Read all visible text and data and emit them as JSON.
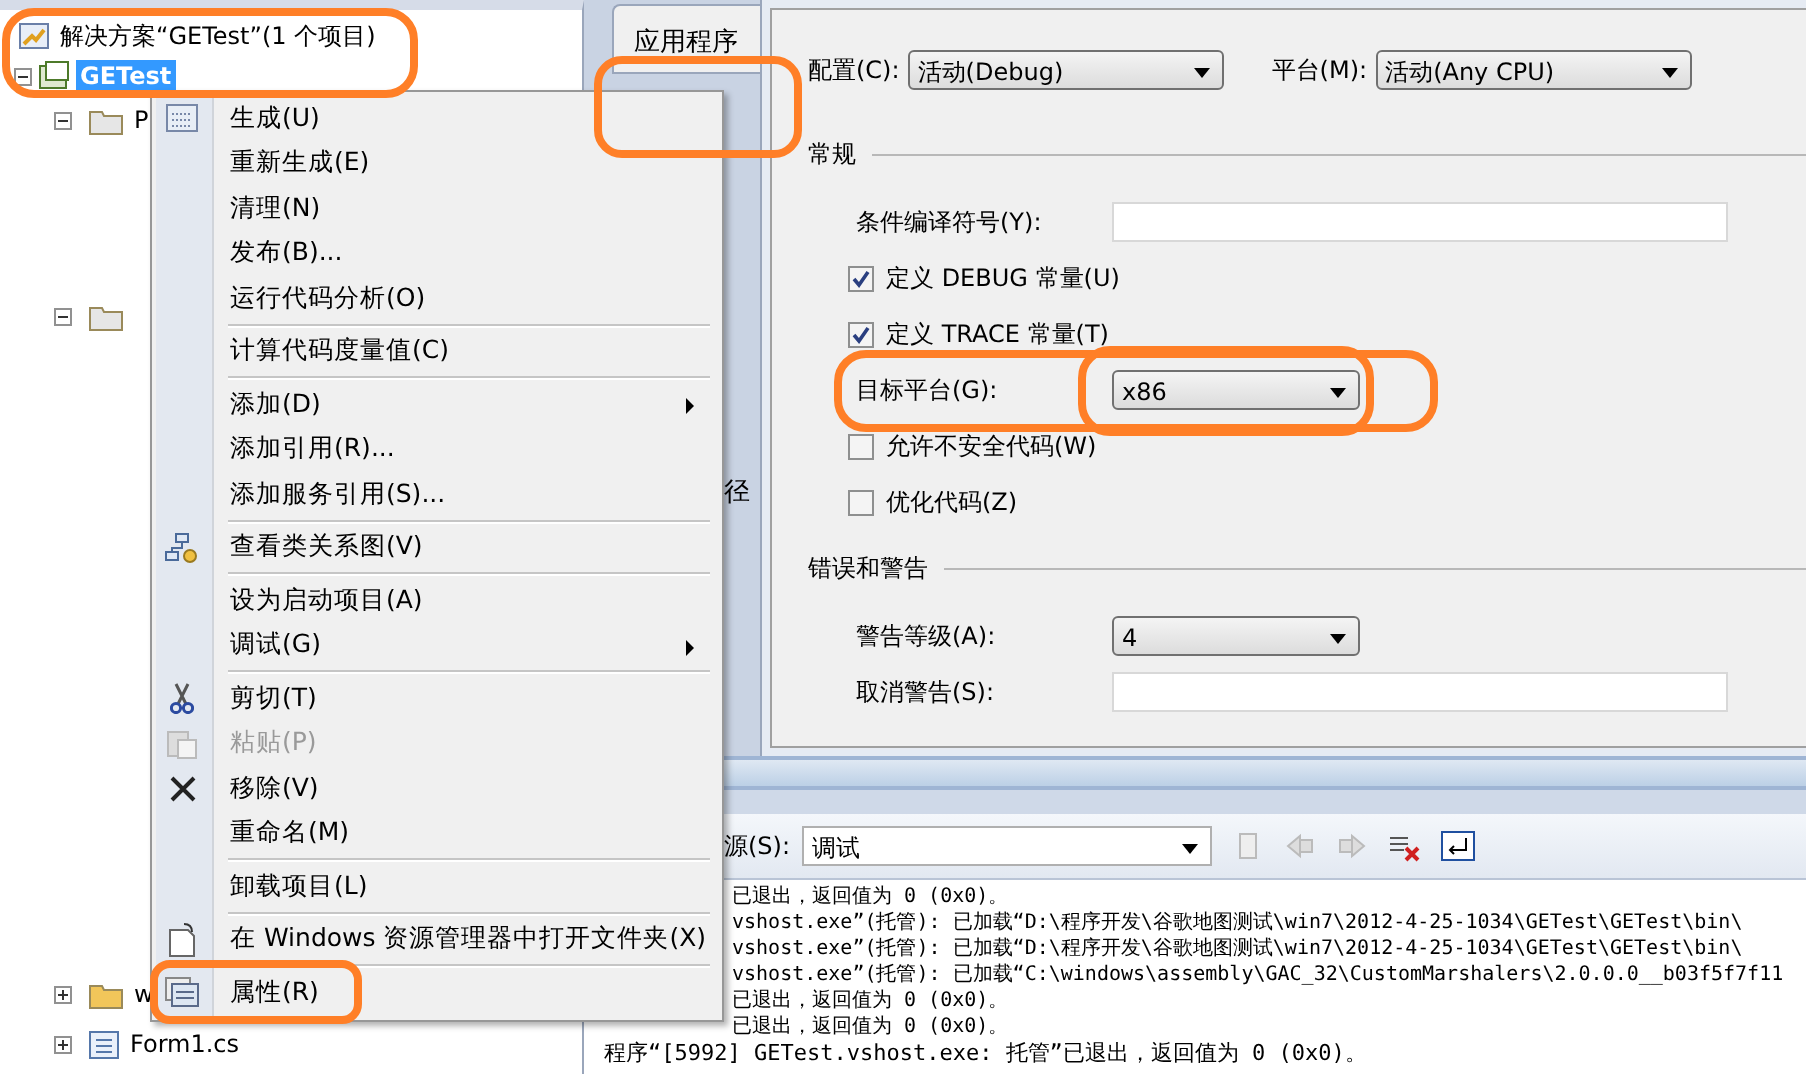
{
  "solution_explorer": {
    "solution": "解决方案“GETest”(1 个项目)",
    "project": {
      "label": "GETest",
      "selected": true,
      "expanded": true
    },
    "items": [
      {
        "label": "P",
        "kind": "folder",
        "expanded": true
      },
      {
        "kind": "folder",
        "expanded": true
      },
      {
        "label": "w",
        "kind": "folder",
        "expanded": false
      },
      {
        "label": "Form1.cs",
        "kind": "form",
        "expanded": false
      }
    ]
  },
  "property_pages": {
    "tabs": [
      {
        "label": "应用程序",
        "selected": true
      },
      {
        "label": "径",
        "selected": false
      }
    ],
    "config": {
      "label": "配置(C):",
      "value": "活动(Debug)"
    },
    "platform": {
      "label": "平台(M):",
      "value": "活动(Any CPU)"
    },
    "sections": [
      {
        "title": "常规",
        "rows": [
          {
            "kind": "text",
            "label": "条件编译符号(Y):"
          },
          {
            "kind": "check",
            "label": "定义 DEBUG 常量(U)",
            "checked": true
          },
          {
            "kind": "check",
            "label": "定义 TRACE 常量(T)",
            "checked": true
          },
          {
            "kind": "select",
            "label": "目标平台(G):",
            "value": "x86"
          },
          {
            "kind": "check",
            "label": "允许不安全代码(W)",
            "checked": false
          },
          {
            "kind": "check",
            "label": "优化代码(Z)",
            "checked": false
          }
        ]
      },
      {
        "title": "错误和警告",
        "rows": [
          {
            "kind": "select",
            "label": "警告等级(A):",
            "value": "4"
          },
          {
            "kind": "text",
            "label": "取消警告(S):"
          }
        ]
      }
    ]
  },
  "output": {
    "source_label": "源(S):",
    "source": "调试",
    "lines": [
      {
        "kind": "partial",
        "text": "已退出，返回值为 0 (0x0)。"
      },
      {
        "kind": "partial",
        "text": "vshost.exe”(托管): 已加载“D:\\程序开发\\谷歌地图测试\\win7\\2012-4-25-1034\\GETest\\GETest\\bin\\"
      },
      {
        "kind": "partial",
        "text": "vshost.exe”(托管): 已加载“D:\\程序开发\\谷歌地图测试\\win7\\2012-4-25-1034\\GETest\\GETest\\bin\\"
      },
      {
        "kind": "partial",
        "text": "vshost.exe”(托管): 已加载“C:\\windows\\assembly\\GAC_32\\CustomMarshalers\\2.0.0.0__b03f5f7f11"
      },
      {
        "kind": "partial",
        "text": "已退出，返回值为 0 (0x0)。"
      },
      {
        "kind": "partial",
        "text": "已退出，返回值为 0 (0x0)。"
      },
      {
        "kind": "full",
        "text": "程序“[5992] GETest.vshost.exe: 托管”已退出，返回值为 0 (0x0)。"
      }
    ]
  },
  "context_menu": {
    "items": [
      {
        "kind": "item",
        "label": "生成(U)",
        "submenu": false,
        "disabled": false
      },
      {
        "kind": "item",
        "label": "重新生成(E)",
        "submenu": false,
        "disabled": false
      },
      {
        "kind": "item",
        "label": "清理(N)",
        "submenu": false,
        "disabled": false
      },
      {
        "kind": "item",
        "label": "发布(B)...",
        "submenu": false,
        "disabled": false
      },
      {
        "kind": "item",
        "label": "运行代码分析(O)",
        "submenu": false,
        "disabled": false
      },
      {
        "kind": "separator"
      },
      {
        "kind": "item",
        "label": "计算代码度量值(C)",
        "submenu": false,
        "disabled": false
      },
      {
        "kind": "separator"
      },
      {
        "kind": "item",
        "label": "添加(D)",
        "submenu": true,
        "disabled": false
      },
      {
        "kind": "item",
        "label": "添加引用(R)...",
        "submenu": false,
        "disabled": false
      },
      {
        "kind": "item",
        "label": "添加服务引用(S)...",
        "submenu": false,
        "disabled": false
      },
      {
        "kind": "separator"
      },
      {
        "kind": "item",
        "label": "查看类关系图(V)",
        "submenu": false,
        "disabled": false
      },
      {
        "kind": "separator"
      },
      {
        "kind": "item",
        "label": "设为启动项目(A)",
        "submenu": false,
        "disabled": false
      },
      {
        "kind": "item",
        "label": "调试(G)",
        "submenu": true,
        "disabled": false
      },
      {
        "kind": "separator"
      },
      {
        "kind": "item",
        "label": "剪切(T)",
        "submenu": false,
        "disabled": false
      },
      {
        "kind": "item",
        "label": "粘贴(P)",
        "submenu": false,
        "disabled": true
      },
      {
        "kind": "item",
        "label": "移除(V)",
        "submenu": false,
        "disabled": false
      },
      {
        "kind": "item",
        "label": "重命名(M)",
        "submenu": false,
        "disabled": false
      },
      {
        "kind": "separator"
      },
      {
        "kind": "item",
        "label": "卸载项目(L)",
        "submenu": false,
        "disabled": false
      },
      {
        "kind": "separator"
      },
      {
        "kind": "item",
        "label": "在 Windows 资源管理器中打开文件夹(X)",
        "submenu": false,
        "disabled": false
      },
      {
        "kind": "separator"
      },
      {
        "kind": "item",
        "label": "属性(R)",
        "submenu": false,
        "disabled": false
      }
    ]
  }
}
